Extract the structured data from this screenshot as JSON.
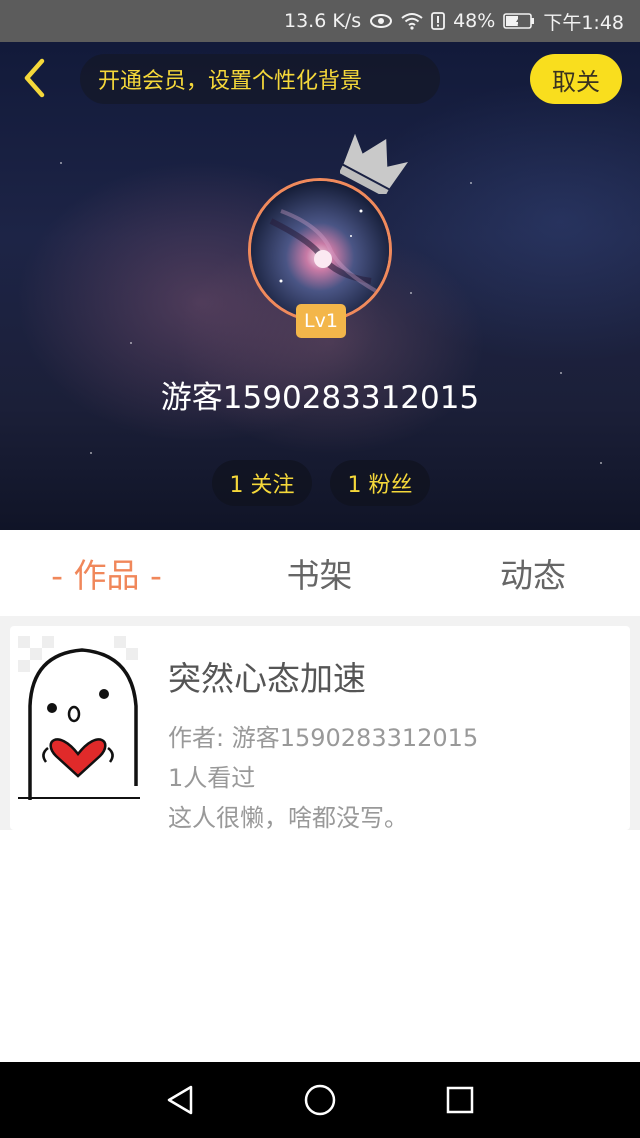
{
  "status_bar": {
    "speed": "13.6 K/s",
    "battery": "48%",
    "time": "下午1:48"
  },
  "header": {
    "promo_text": "开通会员，设置个性化背景",
    "follow_label": "取关"
  },
  "profile": {
    "level": "Lv1",
    "username": "游客1590283312015",
    "following": "1 关注",
    "followers": "1 粉丝"
  },
  "tabs": [
    {
      "label": "- 作品 -",
      "active": true
    },
    {
      "label": "书架",
      "active": false
    },
    {
      "label": "动态",
      "active": false
    }
  ],
  "works": [
    {
      "title": "突然心态加速",
      "author": "作者: 游客1590283312015",
      "views": "1人看过",
      "description": "这人很懒，啥都没写。"
    }
  ],
  "colors": {
    "accent": "#f0875a",
    "yellow": "#f9de1e",
    "gold_text": "#f5d83a",
    "badge": "#f3b64a"
  }
}
